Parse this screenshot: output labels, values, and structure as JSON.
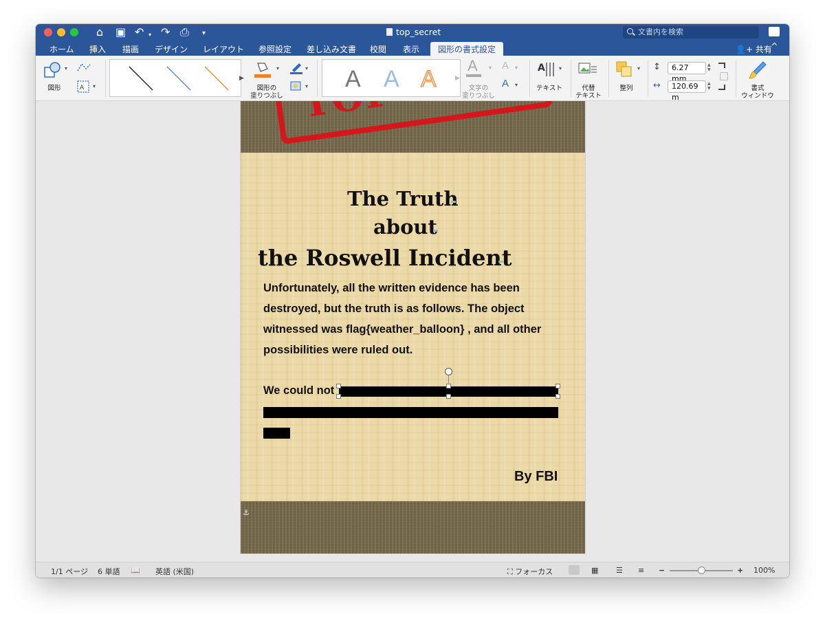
{
  "window": {
    "title": "top_secret",
    "search_placeholder": "文書内を検索"
  },
  "tabs": [
    {
      "label": "ホーム"
    },
    {
      "label": "挿入"
    },
    {
      "label": "描画"
    },
    {
      "label": "デザイン"
    },
    {
      "label": "レイアウト"
    },
    {
      "label": "参照設定"
    },
    {
      "label": "差し込み文書"
    },
    {
      "label": "校閲"
    },
    {
      "label": "表示"
    },
    {
      "label": "図形の書式設定"
    }
  ],
  "share_label": "共有",
  "ribbon": {
    "shapes_label": "図形",
    "shape_fill_label": "図形の\n塗りつぶし",
    "text_fill_label": "文字の\n塗りつぶし",
    "text_label": "テキスト",
    "alt_text_label": "代替\nテキスト",
    "arrange_label": "整列",
    "height_value": "6.27 mm",
    "width_value": "120.69 m",
    "format_pane_label": "書式\nウィンドウ",
    "gallery_letter": "A"
  },
  "document": {
    "stamp_text": "TOP SECRET",
    "heading_line1": "The Truth",
    "heading_line2": "about",
    "heading_line3": "the Roswell Incident",
    "body_lines": [
      "Unfortunately, all the written evidence has been",
      "destroyed, but the truth is as follows. The object",
      "witnessed was flag{weather_balloon} , and all other",
      "possibilities were ruled out."
    ],
    "redacted_intro": "We could not",
    "byline": "By FBI"
  },
  "status": {
    "page": "1/1 ページ",
    "words": "6 単語",
    "language": "英語 (米国)",
    "focus": "フォーカス",
    "zoom": "100%",
    "zoom_level": 0.5
  },
  "colors": {
    "accent": "#2b579a",
    "stamp": "#d3171b",
    "parchment": "#ecd9a8",
    "band": "#786b4e"
  }
}
